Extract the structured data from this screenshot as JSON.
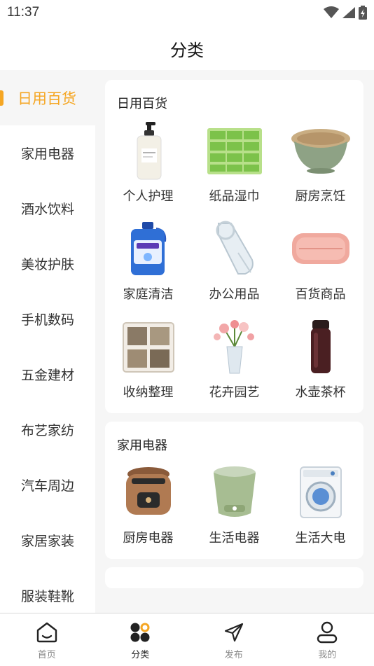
{
  "status_bar": {
    "time": "11:37"
  },
  "header": {
    "title": "分类"
  },
  "sidebar": {
    "items": [
      {
        "label": "日用百货",
        "active": true
      },
      {
        "label": "家用电器"
      },
      {
        "label": "酒水饮料"
      },
      {
        "label": "美妆护肤"
      },
      {
        "label": "手机数码"
      },
      {
        "label": "五金建材"
      },
      {
        "label": "布艺家纺"
      },
      {
        "label": "汽车周边"
      },
      {
        "label": "家居家装"
      },
      {
        "label": "服装鞋靴"
      }
    ]
  },
  "sections": [
    {
      "title": "日用百货",
      "items": [
        {
          "label": "个人护理",
          "icon": "pump-bottle-icon"
        },
        {
          "label": "纸品湿巾",
          "icon": "tissue-boxes-icon"
        },
        {
          "label": "厨房烹饪",
          "icon": "colander-icon"
        },
        {
          "label": "家庭清洁",
          "icon": "detergent-bottle-icon"
        },
        {
          "label": "办公用品",
          "icon": "tape-roll-icon"
        },
        {
          "label": "百货商品",
          "icon": "towel-icon"
        },
        {
          "label": "收纳整理",
          "icon": "storage-box-icon"
        },
        {
          "label": "花卉园艺",
          "icon": "flower-vase-icon"
        },
        {
          "label": "水壶茶杯",
          "icon": "thermos-icon"
        }
      ]
    },
    {
      "title": "家用电器",
      "items": [
        {
          "label": "厨房电器",
          "icon": "rice-cooker-icon"
        },
        {
          "label": "生活电器",
          "icon": "folding-washer-icon"
        },
        {
          "label": "生活大电",
          "icon": "washing-machine-icon"
        }
      ]
    }
  ],
  "tabbar": {
    "tabs": [
      {
        "label": "首页",
        "icon": "home-icon"
      },
      {
        "label": "分类",
        "icon": "category-icon",
        "active": true
      },
      {
        "label": "发布",
        "icon": "send-icon"
      },
      {
        "label": "我的",
        "icon": "user-icon"
      }
    ]
  },
  "colors": {
    "accent": "#f5a623",
    "background": "#f6f6f6"
  }
}
